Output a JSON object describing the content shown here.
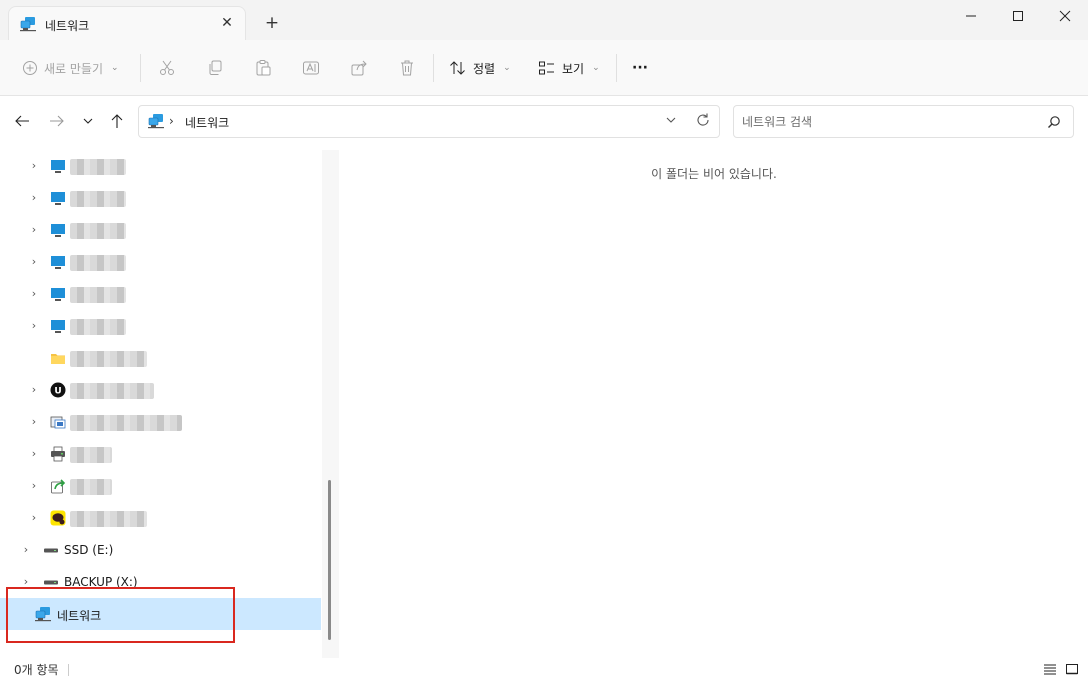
{
  "window": {
    "tab_title": "네트워크",
    "new_tab_symbol": "+",
    "close_tab_symbol": "✕"
  },
  "toolbar": {
    "new_label": "새로 만들기",
    "sort_label": "정렬",
    "view_label": "보기",
    "more_symbol": "···"
  },
  "address": {
    "separator": "›",
    "location": "네트워크",
    "search_placeholder": "네트워크 검색"
  },
  "tree": {
    "drive_ssd": "SSD (E:)",
    "drive_backup": "BACKUP (X:)",
    "network": "네트워크"
  },
  "content": {
    "empty_message": "이 폴더는 비어 있습니다."
  },
  "status": {
    "item_count": "0개 항목"
  },
  "colors": {
    "selection": "#cce8ff",
    "highlight_border": "#d9281f",
    "monitor_blue": "#1e8fd8"
  }
}
